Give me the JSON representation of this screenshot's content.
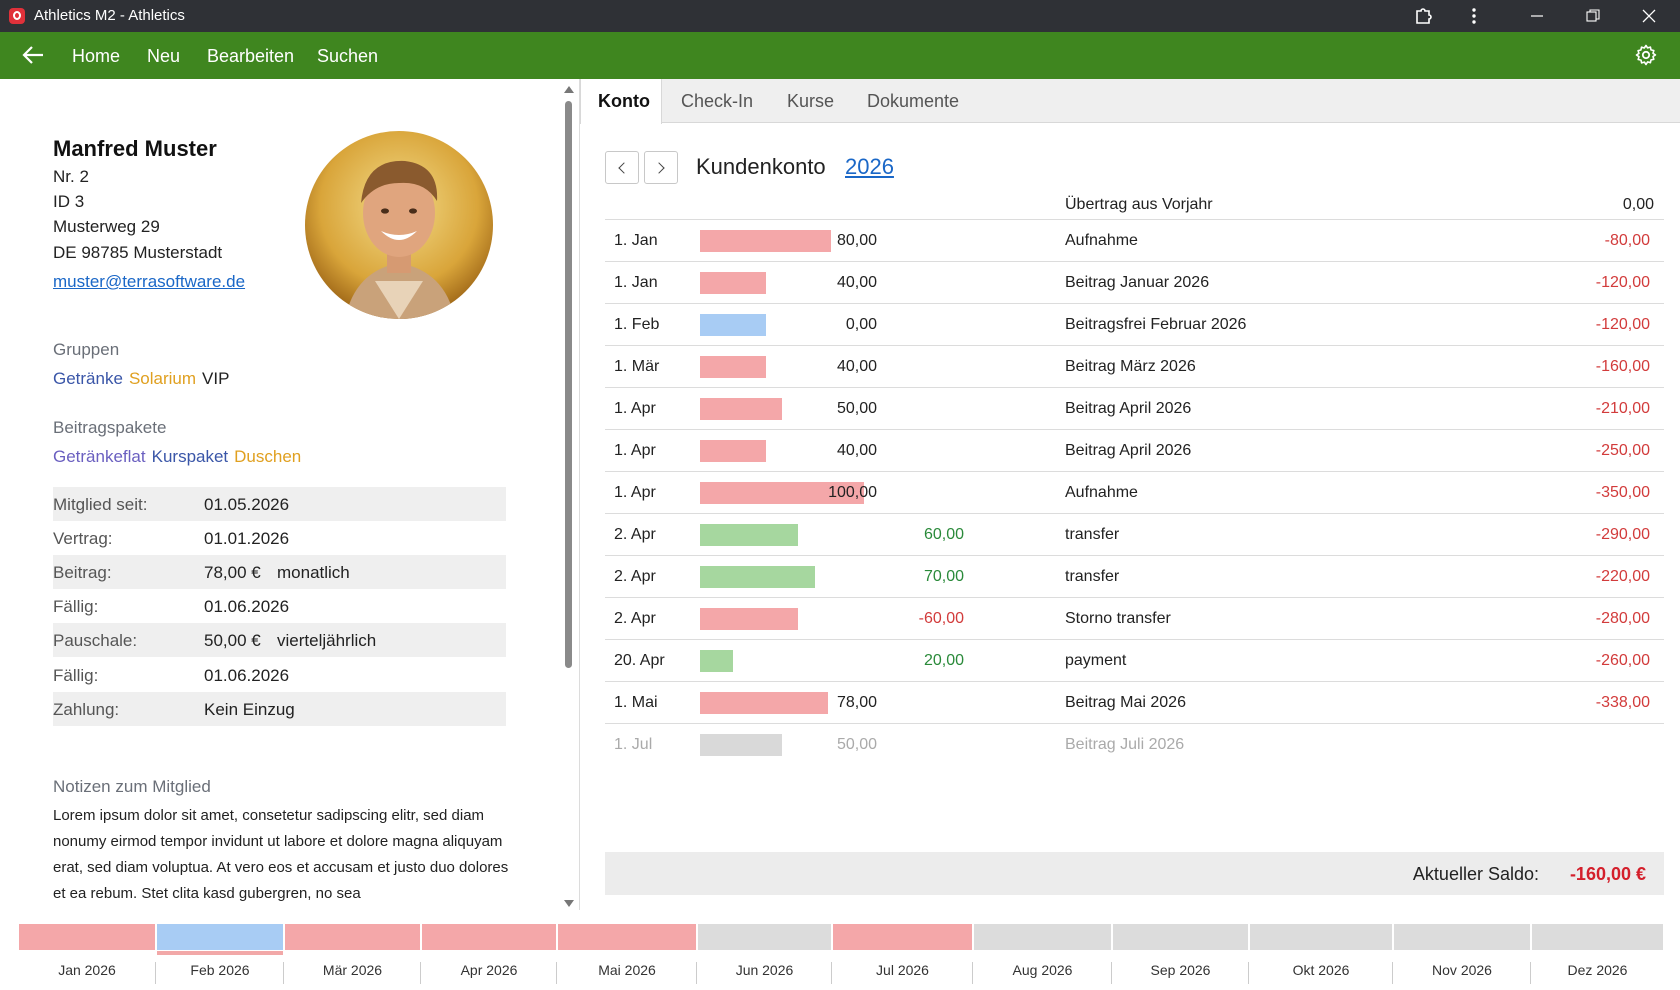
{
  "window": {
    "title": "Athletics M2 - Athletics"
  },
  "menu": {
    "items": [
      "Home",
      "Neu",
      "Bearbeiten",
      "Suchen"
    ]
  },
  "member": {
    "name": "Manfred Muster",
    "nr": "Nr. 2",
    "id": "ID 3",
    "street": "Musterweg 29",
    "city": "DE 98785 Musterstadt",
    "email": "muster@terrasoftware.de"
  },
  "groups": {
    "label": "Gruppen",
    "items": [
      {
        "name": "Getränke",
        "color": "#3a56a8"
      },
      {
        "name": "Solarium",
        "color": "#e0a020"
      },
      {
        "name": "VIP",
        "color": "#222222"
      }
    ]
  },
  "packages": {
    "label": "Beitragspakete",
    "items": [
      {
        "name": "Getränkeflat",
        "color": "#6a5fc0"
      },
      {
        "name": "Kurspaket",
        "color": "#3a56a8"
      },
      {
        "name": "Duschen",
        "color": "#e0a020"
      }
    ]
  },
  "details": [
    {
      "key": "Mitglied seit:",
      "value": "01.05.2026",
      "extra": ""
    },
    {
      "key": "Vertrag:",
      "value": "01.01.2026",
      "extra": ""
    },
    {
      "key": "Beitrag:",
      "value": "78,00 €",
      "extra": "monatlich"
    },
    {
      "key": "Fällig:",
      "value": "01.06.2026",
      "extra": ""
    },
    {
      "key": "Pauschale:",
      "value": "50,00 €",
      "extra": "vierteljährlich"
    },
    {
      "key": "Fällig:",
      "value": "01.06.2026",
      "extra": ""
    },
    {
      "key": "Zahlung:",
      "value": "Kein Einzug",
      "extra": ""
    }
  ],
  "notes": {
    "label": "Notizen zum Mitglied",
    "text": "Lorem ipsum dolor sit amet, consetetur sadipscing elitr, sed diam nonumy eirmod tempor invidunt ut labore et dolore magna aliquyam erat, sed diam voluptua. At vero eos et accusam et justo duo dolores et ea rebum. Stet clita kasd gubergren, no sea"
  },
  "tabs": [
    "Konto",
    "Check-In",
    "Kurse",
    "Dokumente"
  ],
  "account": {
    "title": "Kundenkonto",
    "year": "2026",
    "carry_label": "Übertrag aus Vorjahr",
    "carry_value": "0,00",
    "transactions": [
      {
        "date": "1. Jan",
        "amount": "80,00",
        "credit": "",
        "desc": "Aufnahme",
        "balance": "-80,00",
        "bar_value": 80,
        "kind": "debit"
      },
      {
        "date": "1. Jan",
        "amount": "40,00",
        "credit": "",
        "desc": "Beitrag Januar 2026",
        "balance": "-120,00",
        "bar_value": 40,
        "kind": "debit"
      },
      {
        "date": "1. Feb",
        "amount": "0,00",
        "credit": "",
        "desc": "Beitragsfrei Februar 2026",
        "balance": "-120,00",
        "bar_value": 40,
        "kind": "free"
      },
      {
        "date": "1. Mär",
        "amount": "40,00",
        "credit": "",
        "desc": "Beitrag März 2026",
        "balance": "-160,00",
        "bar_value": 40,
        "kind": "debit"
      },
      {
        "date": "1. Apr",
        "amount": "50,00",
        "credit": "",
        "desc": "Beitrag April 2026",
        "balance": "-210,00",
        "bar_value": 50,
        "kind": "debit"
      },
      {
        "date": "1. Apr",
        "amount": "40,00",
        "credit": "",
        "desc": "Beitrag April 2026",
        "balance": "-250,00",
        "bar_value": 40,
        "kind": "debit"
      },
      {
        "date": "1. Apr",
        "amount": "100,00",
        "credit": "",
        "desc": "Aufnahme",
        "balance": "-350,00",
        "bar_value": 100,
        "kind": "debit"
      },
      {
        "date": "2. Apr",
        "amount": "",
        "credit": "60,00",
        "desc": "transfer",
        "balance": "-290,00",
        "bar_value": 60,
        "kind": "credit"
      },
      {
        "date": "2. Apr",
        "amount": "",
        "credit": "70,00",
        "desc": "transfer",
        "balance": "-220,00",
        "bar_value": 70,
        "kind": "credit"
      },
      {
        "date": "2. Apr",
        "amount": "",
        "credit": "-60,00",
        "desc": "Storno transfer",
        "balance": "-280,00",
        "bar_value": 60,
        "kind": "storno"
      },
      {
        "date": "20. Apr",
        "amount": "",
        "credit": "20,00",
        "desc": "payment",
        "balance": "-260,00",
        "bar_value": 20,
        "kind": "credit"
      },
      {
        "date": "1. Mai",
        "amount": "78,00",
        "credit": "",
        "desc": "Beitrag Mai 2026",
        "balance": "-338,00",
        "bar_value": 78,
        "kind": "debit"
      },
      {
        "date": "1. Jul",
        "amount": "50,00",
        "credit": "",
        "desc": "Beitrag Juli 2026",
        "balance": "",
        "bar_value": 50,
        "kind": "future"
      }
    ],
    "saldo_label": "Aktueller Saldo:",
    "saldo_value": "-160,00 €"
  },
  "colors": {
    "debit": "#f4a7a9",
    "credit": "#a6d79f",
    "free": "#a8ccf4",
    "future": "#d9d9d9",
    "storno": "#f4a7a9",
    "credit_text": "#2a8a3a",
    "storno_text": "#d23b3b"
  },
  "timeline": [
    {
      "label": "Jan 2026",
      "state": "debit"
    },
    {
      "label": "Feb 2026",
      "state": "free",
      "selected": true
    },
    {
      "label": "Mär 2026",
      "state": "debit"
    },
    {
      "label": "Apr 2026",
      "state": "debit"
    },
    {
      "label": "Mai 2026",
      "state": "debit"
    },
    {
      "label": "Jun 2026",
      "state": "none"
    },
    {
      "label": "Jul 2026",
      "state": "debit"
    },
    {
      "label": "Aug 2026",
      "state": "none"
    },
    {
      "label": "Sep 2026",
      "state": "none"
    },
    {
      "label": "Okt 2026",
      "state": "none"
    },
    {
      "label": "Nov 2026",
      "state": "none"
    },
    {
      "label": "Dez 2026",
      "state": "none"
    }
  ]
}
